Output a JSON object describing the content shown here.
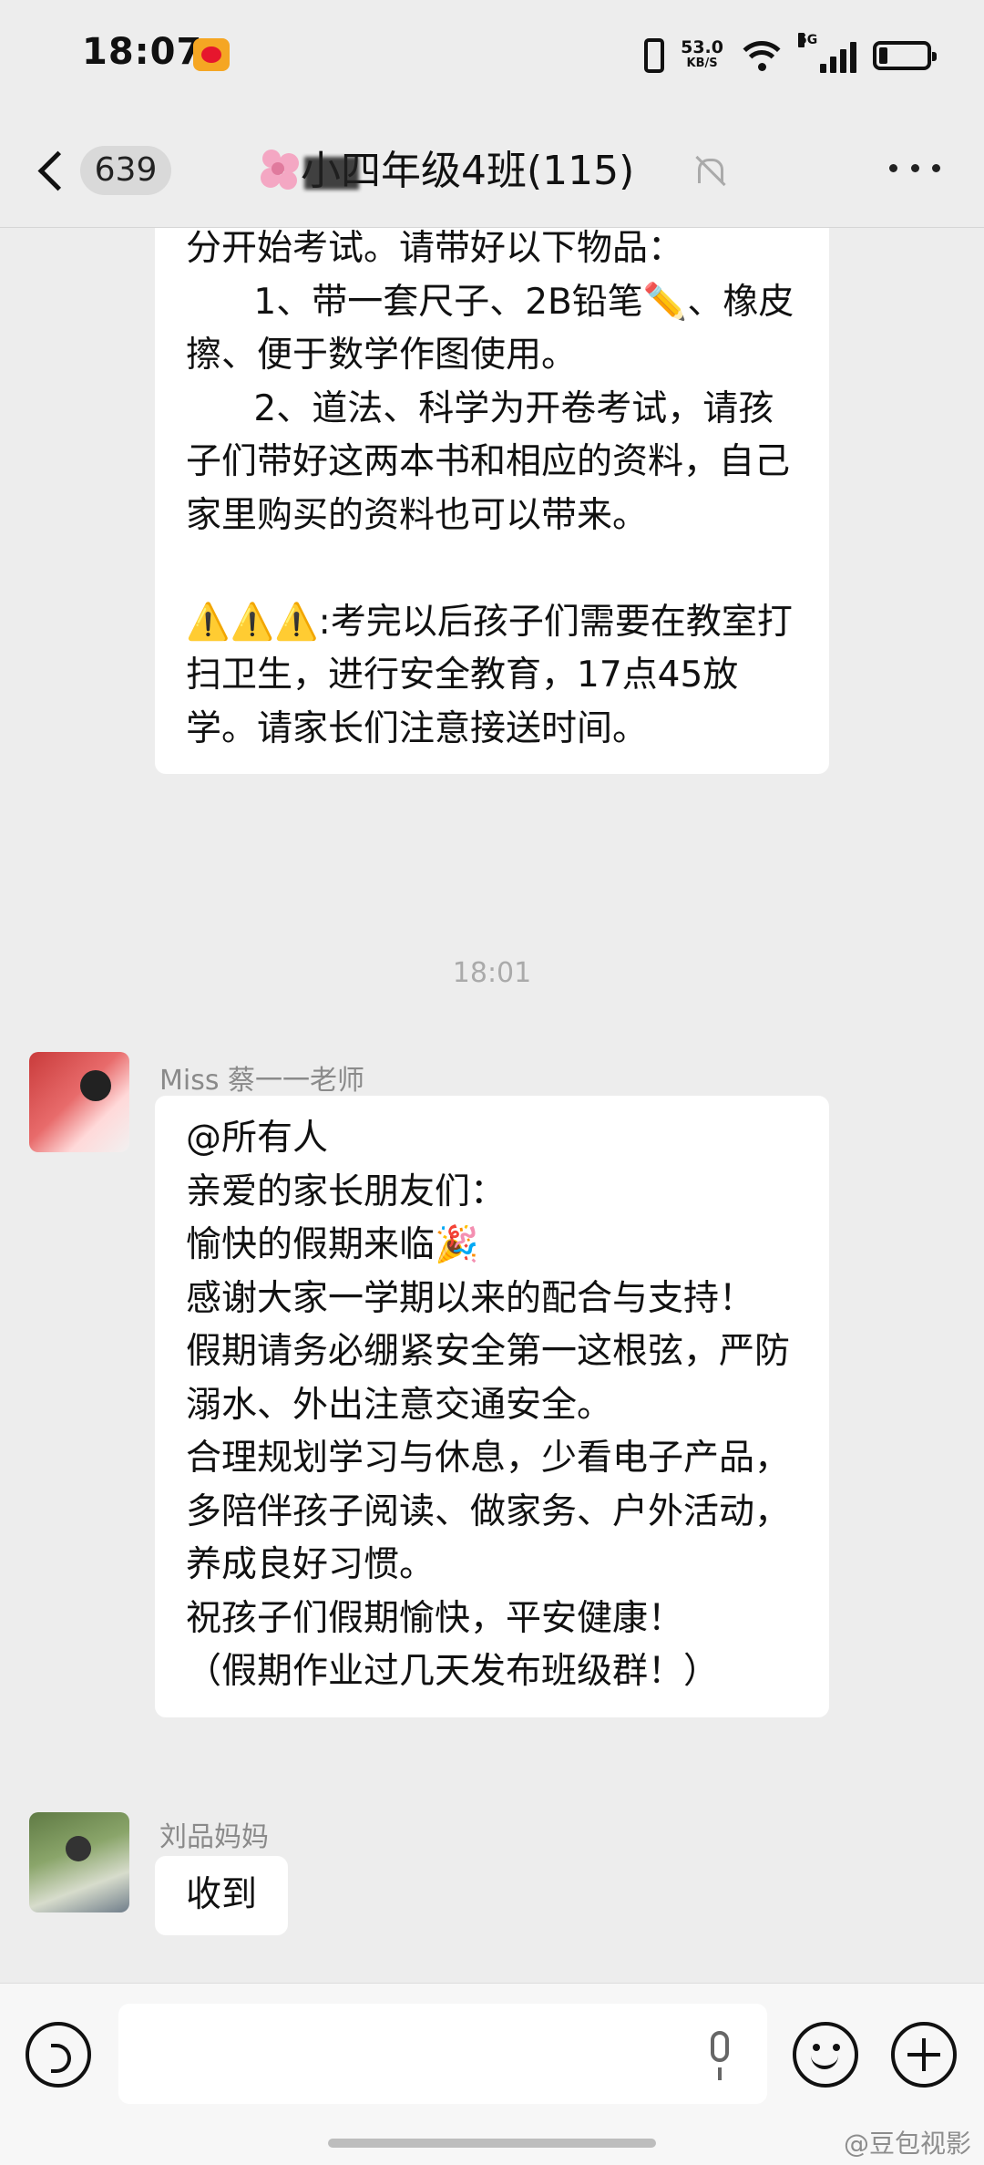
{
  "status_bar": {
    "time": "18:07",
    "net_speed": "53.0",
    "net_unit": "KB/S",
    "signal_label": "5G"
  },
  "header": {
    "unread_count": "639",
    "group_title": "小四年级4班(115)"
  },
  "messages": {
    "first": {
      "text": "分开始考试。请带好以下物品：\n      1、带一套尺子、2B铅笔✏️、橡皮擦、便于数学作图使用。\n      2、道法、科学为开卷考试，请孩子们带好这两本书和相应的资料，自己家里购买的资料也可以带来。\n\n⚠️⚠️⚠️:考完以后孩子们需要在教室打扫卫生，进行安全教育，17点45放学。请家长们注意接送时间。"
    },
    "timestamp": "18:01",
    "second": {
      "sender": "Miss 蔡一一老师",
      "text": "@所有人\n亲爱的家长朋友们：\n愉快的假期来临🎉\n感谢大家一学期以来的配合与支持！\n假期请务必绷紧安全第一这根弦，严防溺水、外出注意交通安全。\n合理规划学习与休息，少看电子产品，多陪伴孩子阅读、做家务、户外活动，养成良好习惯。\n祝孩子们假期愉快，平安健康！\n（假期作业过几天发布班级群！）"
    },
    "third": {
      "sender": "刘品妈妈",
      "text": "收到"
    }
  },
  "input": {
    "placeholder": ""
  },
  "watermark": "@豆包视影"
}
